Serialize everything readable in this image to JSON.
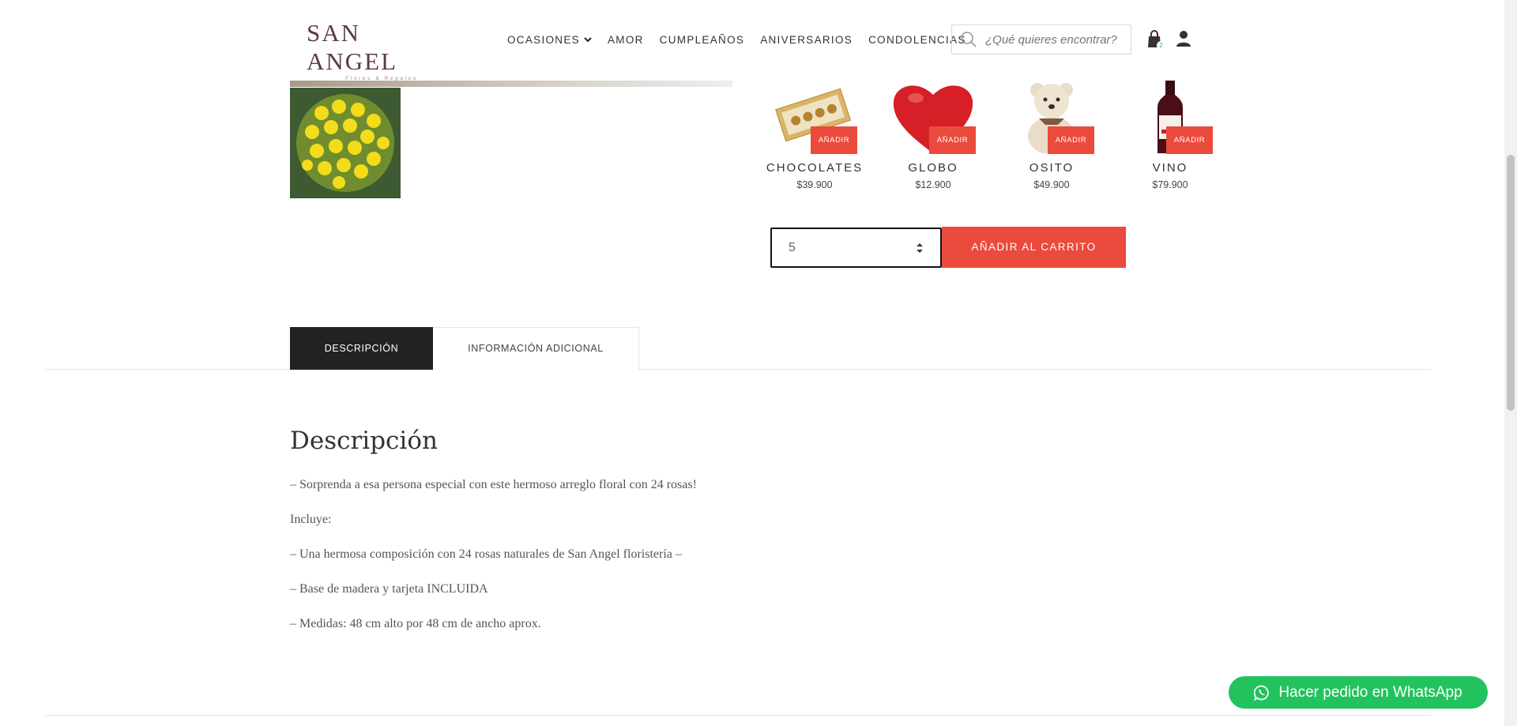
{
  "brand": {
    "name": "SAN ANGEL",
    "tagline": "Flores & Regalos"
  },
  "nav": {
    "items": [
      {
        "label": "OCASIONES"
      },
      {
        "label": "AMOR"
      },
      {
        "label": "CUMPLEAÑOS"
      },
      {
        "label": "ANIVERSARIOS"
      },
      {
        "label": "CONDOLENCIAS"
      }
    ],
    "search_placeholder": "¿Qué quieres encontrar?",
    "cart_count": "2"
  },
  "addons": [
    {
      "name": "CHOCOLATES",
      "price": "$39.900",
      "button": "AÑADIR",
      "icon": "chocolates-image"
    },
    {
      "name": "GLOBO",
      "price": "$12.900",
      "button": "AÑADIR",
      "icon": "heart-balloon-image"
    },
    {
      "name": "OSITO",
      "price": "$49.900",
      "button": "AÑADIR",
      "icon": "teddy-bear-image"
    },
    {
      "name": "VINO",
      "price": "$79.900",
      "button": "AÑADIR",
      "icon": "wine-bottle-image"
    }
  ],
  "purchase": {
    "quantity": "5",
    "add_to_cart": "AÑADIR AL CARRITO"
  },
  "tabs": [
    {
      "label": "DESCRIPCIÓN",
      "active": true
    },
    {
      "label": "INFORMACIÓN ADICIONAL",
      "active": false
    }
  ],
  "description": {
    "title": "Descripción",
    "lines": [
      "– Sorprenda a esa persona especial con este hermoso arreglo floral con 24 rosas!",
      "Incluye:",
      "– Una hermosa composición con 24 rosas naturales de San Angel floristería –",
      "– Base de madera y tarjeta INCLUIDA",
      "– Medidas: 48 cm alto por 48 cm de ancho aprox."
    ]
  },
  "whatsapp": {
    "label": "Hacer pedido en WhatsApp"
  },
  "colors": {
    "accent": "#ea4b3d",
    "dark": "#222222",
    "whatsapp": "#22c35e",
    "brand": "#5a3b3f"
  }
}
